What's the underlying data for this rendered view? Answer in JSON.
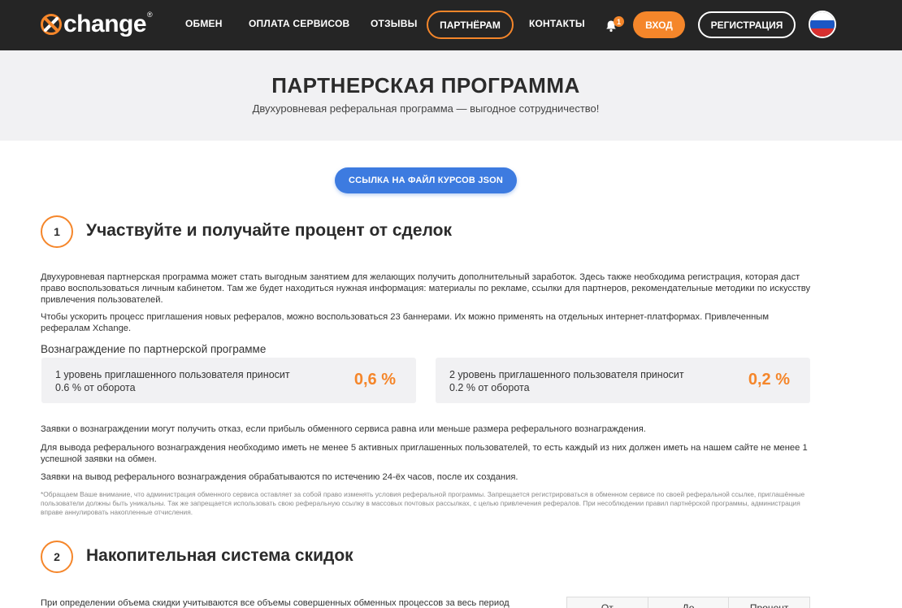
{
  "header": {
    "logo_text": "change",
    "logo_reg": "®",
    "nav": {
      "exchange": "ОБМЕН",
      "services": "ОПЛАТА СЕРВИСОВ",
      "reviews": "ОТЗЫВЫ",
      "partners": "ПАРТНЁРАМ",
      "contacts": "КОНТАКТЫ"
    },
    "notification_count": "1",
    "login": "ВХОД",
    "register": "РЕГИСТРАЦИЯ",
    "language_flag": "russia-flag-icon"
  },
  "hero": {
    "title": "ПАРТНЕРСКАЯ ПРОГРАММА",
    "subtitle": "Двухуровневая реферальная программа — выгодное сотрудничество!"
  },
  "json_button": "ССЫЛКА НА ФАЙЛ КУРСОВ JSON",
  "section1": {
    "number": "1",
    "title": "Участвуйте и получайте процент от сделок",
    "p1": "Двухуровневая партнерская программа может стать выгодным занятием для желающих получить дополнительный заработок. Здесь также необходима регистрация, которая даст право воспользоваться личным кабинетом. Там же будет находиться нужная информация: материалы по рекламе, ссылки для партнеров, рекомендательные методики по искусству привлечения пользователей.",
    "p2": "Чтобы ускорить процесс приглашения новых рефералов, можно воспользоваться 23 баннерами. Их можно применять на отдельных интернет-платформах. Привлеченным рефералам Xchange.",
    "reward_heading": "Вознаграждение по партнерской программе",
    "level1_text": "1 уровень приглашенного пользователя приносит 0.6 % от оборота",
    "level1_value": "0,6 %",
    "level2_text": "2 уровень приглашенного пользователя приносит 0.2 % от оборота",
    "level2_value": "0,2 %",
    "p3": "Заявки о вознаграждении могут получить отказ, если прибыль обменного сервиса равна или меньше размера реферального вознаграждения.",
    "p4": "Для вывода реферального вознаграждения необходимо иметь не менее 5 активных приглашенных пользователей, то есть каждый из них должен иметь на нашем сайте не менее 1 успешной заявки на обмен.",
    "p5": "Заявки на вывод реферального вознаграждения обрабатываются по истечению 24-ёх часов, после их создания.",
    "note": "*Обращаем Ваше внимание, что администрация обменного сервиса оставляет за собой право изменять условия реферальной программы. Запрещается регистрироваться в обменном сервисе по своей реферальной ссылке, приглашённые пользователи должны быть уникальны. Так же запрещается использовать свою реферальную ссылку в массовых почтовых рассылках, с целью привлечения рефералов. При несоблюдении правил партнёрской программы, администрация вправе аннулировать накопленные отчисления."
  },
  "section2": {
    "number": "2",
    "title": "Накопительная система скидок",
    "p1": "При определении объема скидки учитываются все объемы совершенных обменных процессов за весь период",
    "table_headers": [
      "От",
      "До",
      "Процент"
    ]
  },
  "colors": {
    "accent": "#f5862a",
    "header_bg": "#252525",
    "hero_bg": "#f1f1f3",
    "button_blue": "#3d7be0"
  }
}
